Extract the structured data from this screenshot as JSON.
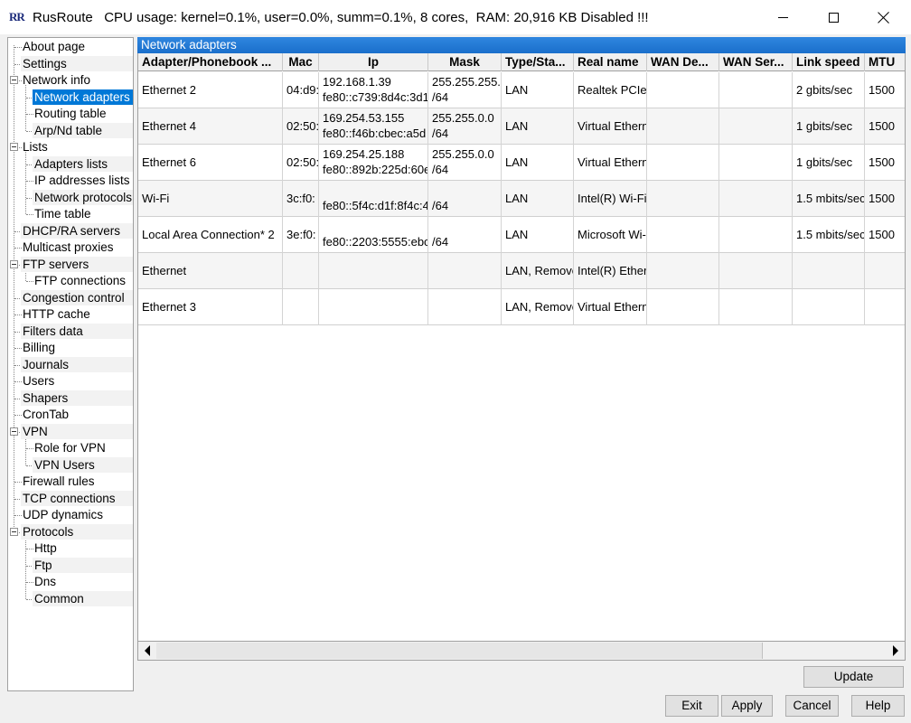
{
  "window": {
    "icon_text": "RR",
    "title": "RusRoute   CPU usage: kernel=0.1%, user=0.0%, summ=0.1%, 8 cores,  RAM: 20,916 KB Disabled !!!"
  },
  "tree": {
    "items": [
      {
        "label": "About page"
      },
      {
        "label": "Settings"
      },
      {
        "label": "Network info"
      },
      {
        "label": "Network adapters"
      },
      {
        "label": "Routing table"
      },
      {
        "label": "Arp/Nd table"
      },
      {
        "label": "Lists"
      },
      {
        "label": "Adapters lists"
      },
      {
        "label": "IP addresses lists"
      },
      {
        "label": "Network protocols"
      },
      {
        "label": "Time table"
      },
      {
        "label": "DHCP/RA servers"
      },
      {
        "label": "Multicast proxies"
      },
      {
        "label": "FTP servers"
      },
      {
        "label": "FTP connections"
      },
      {
        "label": "Congestion control"
      },
      {
        "label": "HTTP cache"
      },
      {
        "label": "Filters data"
      },
      {
        "label": "Billing"
      },
      {
        "label": "Journals"
      },
      {
        "label": "Users"
      },
      {
        "label": "Shapers"
      },
      {
        "label": "CronTab"
      },
      {
        "label": "VPN"
      },
      {
        "label": "Role for VPN"
      },
      {
        "label": "VPN Users"
      },
      {
        "label": "Firewall rules"
      },
      {
        "label": "TCP connections"
      },
      {
        "label": "UDP dynamics"
      },
      {
        "label": "Protocols"
      },
      {
        "label": "Http"
      },
      {
        "label": "Ftp"
      },
      {
        "label": "Dns"
      },
      {
        "label": "Common"
      }
    ]
  },
  "panel": {
    "title": "Network adapters",
    "columns": [
      "Adapter/Phonebook ...",
      "Mac",
      "Ip",
      "Mask",
      "Type/Sta...",
      "Real name",
      "WAN De...",
      "WAN Ser...",
      "Link speed",
      "MTU"
    ],
    "rows": [
      {
        "adapter": "Ethernet 2",
        "mac": "04:d9:",
        "ip1": "192.168.1.39",
        "ip2": "fe80::c739:8d4c:3d1",
        "mask1": "255.255.255.",
        "mask2": "/64",
        "type": "LAN",
        "real": "Realtek PCIe",
        "wan_dev": "",
        "wan_srv": "",
        "speed": "2 gbits/sec",
        "mtu": "1500"
      },
      {
        "adapter": "Ethernet 4",
        "mac": "02:50:",
        "ip1": "169.254.53.155",
        "ip2": "fe80::f46b:cbec:a5d",
        "mask1": "255.255.0.0",
        "mask2": "/64",
        "type": "LAN",
        "real": "Virtual Ethern",
        "wan_dev": "",
        "wan_srv": "",
        "speed": "1 gbits/sec",
        "mtu": "1500"
      },
      {
        "adapter": "Ethernet 6",
        "mac": "02:50:",
        "ip1": "169.254.25.188",
        "ip2": "fe80::892b:225d:60e",
        "mask1": "255.255.0.0",
        "mask2": "/64",
        "type": "LAN",
        "real": "Virtual Ethern",
        "wan_dev": "",
        "wan_srv": "",
        "speed": "1 gbits/sec",
        "mtu": "1500"
      },
      {
        "adapter": "Wi-Fi",
        "mac": "3c:f0:",
        "ip1": "",
        "ip2": "fe80::5f4c:d1f:8f4c:4",
        "mask1": "",
        "mask2": "/64",
        "type": "LAN",
        "real": "Intel(R) Wi-Fi",
        "wan_dev": "",
        "wan_srv": "",
        "speed": "1.5 mbits/sec",
        "mtu": "1500"
      },
      {
        "adapter": "Local Area Connection* 2",
        "mac": "3e:f0:",
        "ip1": "",
        "ip2": "fe80::2203:5555:ebc",
        "mask1": "",
        "mask2": "/64",
        "type": "LAN",
        "real": "Microsoft Wi-",
        "wan_dev": "",
        "wan_srv": "",
        "speed": "1.5 mbits/sec",
        "mtu": "1500"
      },
      {
        "adapter": "Ethernet",
        "mac": "",
        "ip1": "",
        "ip2": "",
        "mask1": "",
        "mask2": "",
        "type": "LAN, Remove",
        "real": "Intel(R) Ether",
        "wan_dev": "",
        "wan_srv": "",
        "speed": "",
        "mtu": ""
      },
      {
        "adapter": "Ethernet 3",
        "mac": "",
        "ip1": "",
        "ip2": "",
        "mask1": "",
        "mask2": "",
        "type": "LAN, Remove",
        "real": "Virtual Ethern",
        "wan_dev": "",
        "wan_srv": "",
        "speed": "",
        "mtu": ""
      }
    ]
  },
  "buttons": {
    "update": "Update",
    "exit": "Exit",
    "apply": "Apply",
    "cancel": "Cancel",
    "help": "Help"
  },
  "colors": {
    "selection": "#0078d7",
    "panel_header": "#2f86df"
  }
}
